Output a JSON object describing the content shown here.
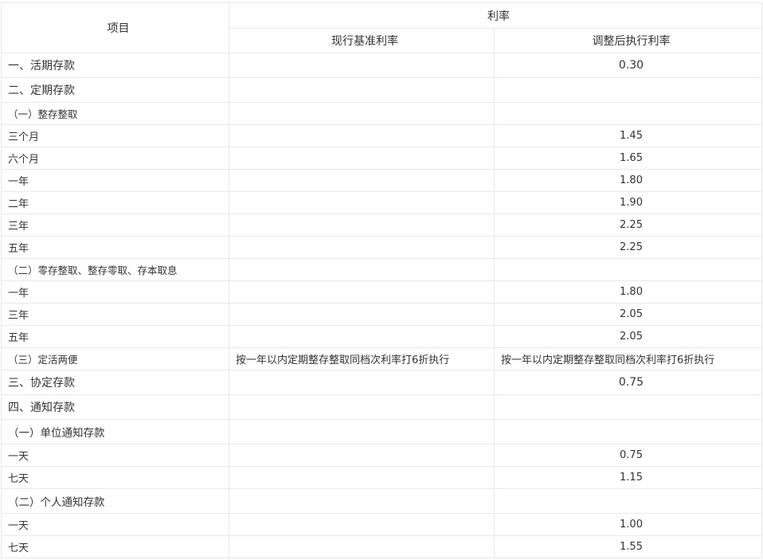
{
  "header": {
    "item_label": "项目",
    "rate_group": "利率",
    "current_rate": "现行基准利率",
    "adjusted_rate": "调整后执行利率"
  },
  "rows": [
    {
      "label": "一、活期存款",
      "current": "",
      "adjusted": "0.30"
    },
    {
      "label": "二、定期存款",
      "current": "",
      "adjusted": ""
    },
    {
      "label": "（一）整存整取",
      "current": "",
      "adjusted": ""
    },
    {
      "label": "三个月",
      "current": "",
      "adjusted": "1.45"
    },
    {
      "label": "六个月",
      "current": "",
      "adjusted": "1.65"
    },
    {
      "label": "一年",
      "current": "",
      "adjusted": "1.80"
    },
    {
      "label": "二年",
      "current": "",
      "adjusted": "1.90"
    },
    {
      "label": "三年",
      "current": "",
      "adjusted": "2.25"
    },
    {
      "label": "五年",
      "current": "",
      "adjusted": "2.25"
    },
    {
      "label": "（二）零存整取、整存零取、存本取息",
      "current": "",
      "adjusted": ""
    },
    {
      "label": "一年",
      "current": "",
      "adjusted": "1.80"
    },
    {
      "label": "三年",
      "current": "",
      "adjusted": "2.05"
    },
    {
      "label": "五年",
      "current": "",
      "adjusted": "2.05"
    },
    {
      "label": "（三）定活两便",
      "current": "按一年以内定期整存整取同档次利率打6折执行",
      "adjusted": "按一年以内定期整存整取同档次利率打6折执行"
    },
    {
      "label": "三、协定存款",
      "current": "",
      "adjusted": "0.75"
    },
    {
      "label": "四、通知存款",
      "current": "",
      "adjusted": ""
    },
    {
      "label": "（一）单位通知存款",
      "current": "",
      "adjusted": ""
    },
    {
      "label": "一天",
      "current": "",
      "adjusted": "0.75"
    },
    {
      "label": "七天",
      "current": "",
      "adjusted": "1.15"
    },
    {
      "label": "（二）个人通知存款",
      "current": "",
      "adjusted": ""
    },
    {
      "label": "一天",
      "current": "",
      "adjusted": "1.00"
    },
    {
      "label": "七天",
      "current": "",
      "adjusted": "1.55"
    }
  ]
}
